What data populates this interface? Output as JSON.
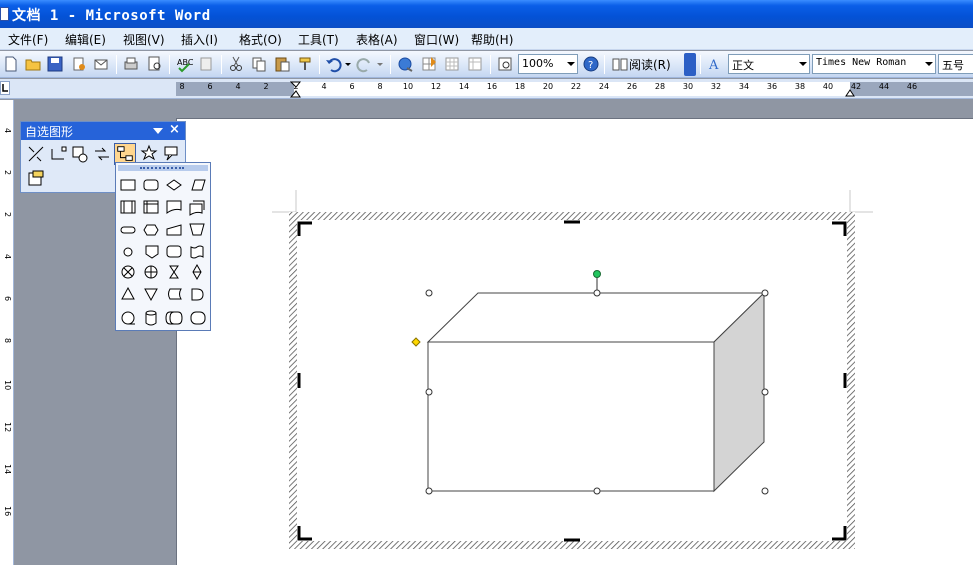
{
  "window": {
    "title": "文档 1 - Microsoft Word"
  },
  "menu": {
    "items": [
      {
        "label": "文件(F)"
      },
      {
        "label": "编辑(E)"
      },
      {
        "label": "视图(V)"
      },
      {
        "label": "插入(I)"
      },
      {
        "label": "格式(O)"
      },
      {
        "label": "工具(T)"
      },
      {
        "label": "表格(A)"
      },
      {
        "label": "窗口(W)"
      },
      {
        "label": "帮助(H)"
      }
    ]
  },
  "toolbar": {
    "zoom": "100%",
    "read_label": "阅读(R)",
    "style": "正文",
    "font": "Times New Roman",
    "size": "五号"
  },
  "ruler": {
    "h_labels": [
      "8",
      "6",
      "4",
      "2",
      "2",
      "4",
      "6",
      "8",
      "10",
      "12",
      "14",
      "16",
      "18",
      "20",
      "22",
      "24",
      "26",
      "28",
      "30",
      "32",
      "34",
      "36",
      "38",
      "40",
      "42",
      "44",
      "46"
    ],
    "v_labels": [
      "4",
      "2",
      "2",
      "4",
      "6",
      "8",
      "10",
      "12",
      "14",
      "16"
    ]
  },
  "autoshape": {
    "title": "自选图形"
  },
  "colors": {
    "titlebar": "#0452d6",
    "menubar": "#e3eefb",
    "selected_handle": "#22c55e",
    "adjust_handle": "#ffd700",
    "box_side": "#d4d4d4"
  }
}
